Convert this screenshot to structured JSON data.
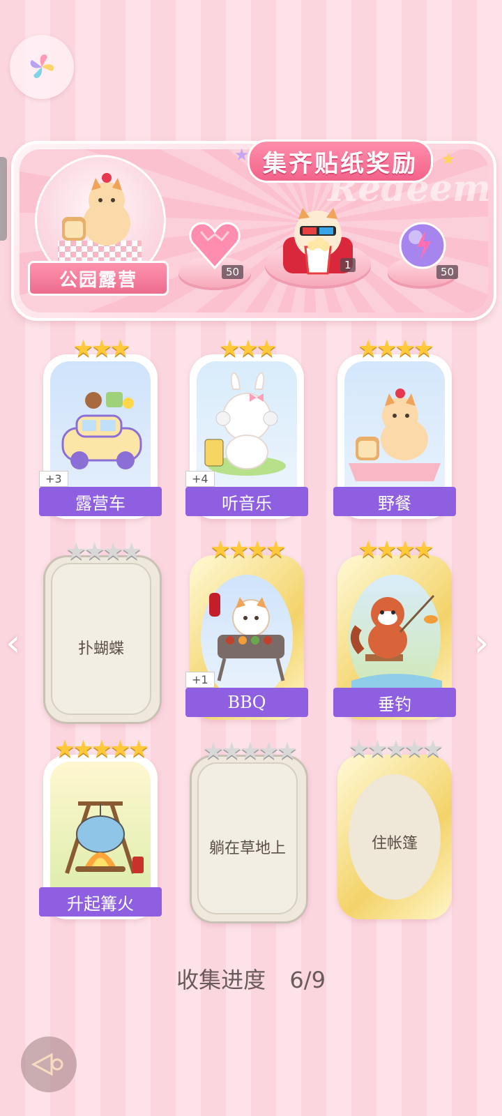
{
  "header": {
    "logo_icon": "pinwheel-logo-icon"
  },
  "reward_panel": {
    "title": "集齐贴纸奖励",
    "watermark": "Redeem",
    "scene_label": "公园露营",
    "rewards": [
      {
        "icon": "pink-heart-gem-icon",
        "count": "50"
      },
      {
        "icon": "popcorn-cinema-cat-icon",
        "count": "1"
      },
      {
        "icon": "purple-energy-orb-icon",
        "count": "50"
      }
    ]
  },
  "cards": [
    {
      "name": "露营车",
      "stars": 3,
      "bonus": "+3",
      "state": "owned"
    },
    {
      "name": "听音乐",
      "stars": 3,
      "bonus": "+4",
      "state": "owned"
    },
    {
      "name": "野餐",
      "stars": 4,
      "bonus": "",
      "state": "owned"
    },
    {
      "name": "扑蝴蝶",
      "stars": 4,
      "bonus": "",
      "state": "locked"
    },
    {
      "name": "BBQ",
      "stars": 4,
      "bonus": "+1",
      "state": "owned-gold"
    },
    {
      "name": "垂钓",
      "stars": 4,
      "bonus": "",
      "state": "owned-gold"
    },
    {
      "name": "升起篝火",
      "stars": 5,
      "bonus": "",
      "state": "owned"
    },
    {
      "name": "躺在草地上",
      "stars": 5,
      "bonus": "",
      "state": "locked"
    },
    {
      "name": "住帐篷",
      "stars": 5,
      "bonus": "",
      "state": "locked-gold"
    }
  ],
  "progress": {
    "label": "收集进度",
    "value": "6/9"
  },
  "nav": {
    "left_arrow": "chevron-left-icon",
    "right_arrow": "chevron-right-icon",
    "back": "back-arrow-icon"
  }
}
